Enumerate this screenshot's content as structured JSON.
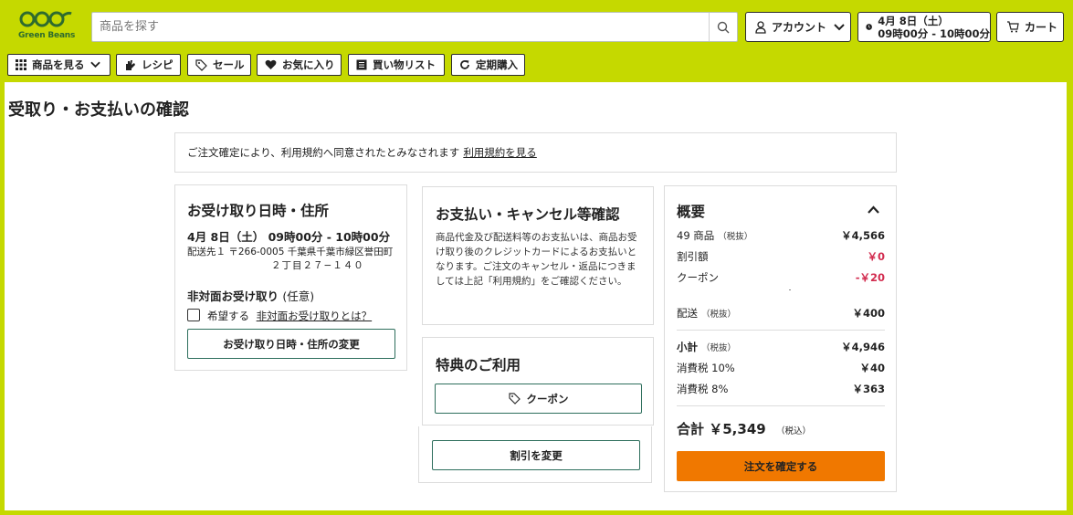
{
  "brand": {
    "name": "Green Beans"
  },
  "search": {
    "placeholder": "商品を探す"
  },
  "header": {
    "account_label": "アカウント",
    "delivery_date": "4月 8日（土）",
    "delivery_time": "09時00分 - 10時00分",
    "cart_label": "カート"
  },
  "nav": {
    "items": [
      {
        "label": "商品を見る"
      },
      {
        "label": "レシピ"
      },
      {
        "label": "セール"
      },
      {
        "label": "お気に入り"
      },
      {
        "label": "買い物リスト"
      },
      {
        "label": "定期購入"
      }
    ]
  },
  "page": {
    "title": "受取り・お支払いの確認",
    "notice_text": "ご注文確定により、利用規約へ同意されたとみなされます",
    "notice_link": "利用規約を見る"
  },
  "pickup": {
    "title": "お受け取り日時・住所",
    "datetime": "4月 8日（土） 09時00分 - 10時00分",
    "address_line1": "配送先１ 〒266-0005 千葉県千葉市緑区誉田町",
    "address_line2": "２丁目２７−１４０",
    "nonface_label": "非対面お受け取り",
    "nonface_optional": "(任意)",
    "want_label": "希望する",
    "want_link": "非対面お受け取りとは？",
    "change_button": "お受け取り日時・住所の変更"
  },
  "payment": {
    "title": "お支払い・キャンセル等確認",
    "body": "商品代金及び配送料等のお支払いは、商品お受け取り後のクレジットカードによるお支払いとなります。ご注文のキャンセル・返品につきましては上記「利用規約」をご確認ください。"
  },
  "benefits": {
    "title": "特典のご利用",
    "coupon_button": "クーポン",
    "discount_button": "割引を変更"
  },
  "summary": {
    "title": "概要",
    "items_label": "49 商品",
    "items_note": "（税抜）",
    "items_value": "￥4,566",
    "discount_label": "割引額",
    "discount_value": "￥0",
    "coupon_label": "クーポン",
    "coupon_value": "-￥20",
    "shipping_label": "配送",
    "shipping_note": "（税抜）",
    "shipping_value": "￥400",
    "subtotal_label": "小計",
    "subtotal_note": "（税抜）",
    "subtotal_value": "￥4,946",
    "tax10_label": "消費税 10%",
    "tax10_value": "￥40",
    "tax8_label": "消費税 8%",
    "tax8_value": "￥363",
    "total_label": "合計",
    "total_value": "￥5,349",
    "total_note": "（税込）",
    "confirm_button": "注文を確定する"
  },
  "colors": {
    "brand_lime": "#c5d900",
    "confirm_orange": "#f07800",
    "discount_red": "#d22c4f",
    "button_border_green": "#2d6e5c"
  }
}
